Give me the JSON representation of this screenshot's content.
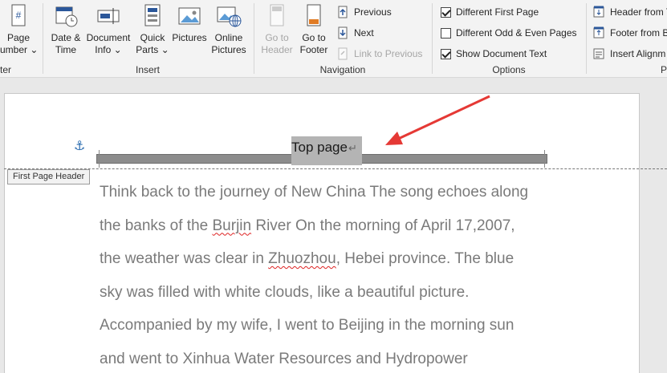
{
  "ribbon": {
    "groups": {
      "header_footer": {
        "label": "ter"
      },
      "insert": {
        "label": "Insert"
      },
      "navigation": {
        "label": "Navigation"
      },
      "options": {
        "label": "Options"
      },
      "position": {
        "label": "Po"
      }
    },
    "page_number": {
      "line1": "Page",
      "line2": "umber ⌄"
    },
    "date_time": {
      "line1": "Date &",
      "line2": "Time"
    },
    "document_info": {
      "line1": "Document",
      "line2": "Info ⌄"
    },
    "quick_parts": {
      "line1": "Quick",
      "line2": "Parts ⌄"
    },
    "pictures": {
      "line1": "Pictures"
    },
    "online_pictures": {
      "line1": "Online",
      "line2": "Pictures"
    },
    "go_to_header": {
      "line1": "Go to",
      "line2": "Header"
    },
    "go_to_footer": {
      "line1": "Go to",
      "line2": "Footer"
    },
    "previous": "Previous",
    "next": "Next",
    "link_to_previous": "Link to Previous",
    "different_first_page": "Different First Page",
    "different_odd_even": "Different Odd & Even Pages",
    "show_document_text": "Show Document Text",
    "header_from_top": "Header from T",
    "footer_from_bottom": "Footer from B",
    "insert_alignment": "Insert Alignm",
    "checkbox_states": {
      "different_first_page": true,
      "different_odd_even": false,
      "show_document_text": true
    }
  },
  "document": {
    "header_text": "Top page",
    "header_mark": "↵",
    "header_tag": "First Page Header",
    "lines": [
      {
        "parts": [
          {
            "t": "Think back to the journey of New China The song echoes along"
          }
        ]
      },
      {
        "parts": [
          {
            "t": "the banks of the "
          },
          {
            "t": "Burjin",
            "spell": true
          },
          {
            "t": " River On the morning of April 17,2007,"
          }
        ]
      },
      {
        "parts": [
          {
            "t": "the weather was clear in "
          },
          {
            "t": "Zhuozhou",
            "spell": true
          },
          {
            "t": ", Hebei province. The blue"
          }
        ]
      },
      {
        "parts": [
          {
            "t": "sky was filled with white clouds, like a beautiful picture."
          }
        ]
      },
      {
        "parts": [
          {
            "t": "Accompanied by my wife, I went to Beijing in the morning sun"
          }
        ]
      },
      {
        "parts": [
          {
            "t": "and went to Xinhua Water Resources and Hydropower"
          }
        ]
      }
    ]
  },
  "colors": {
    "accent": "#2b579a",
    "arrow": "#e53935",
    "anchor": "#2b6cb0"
  }
}
